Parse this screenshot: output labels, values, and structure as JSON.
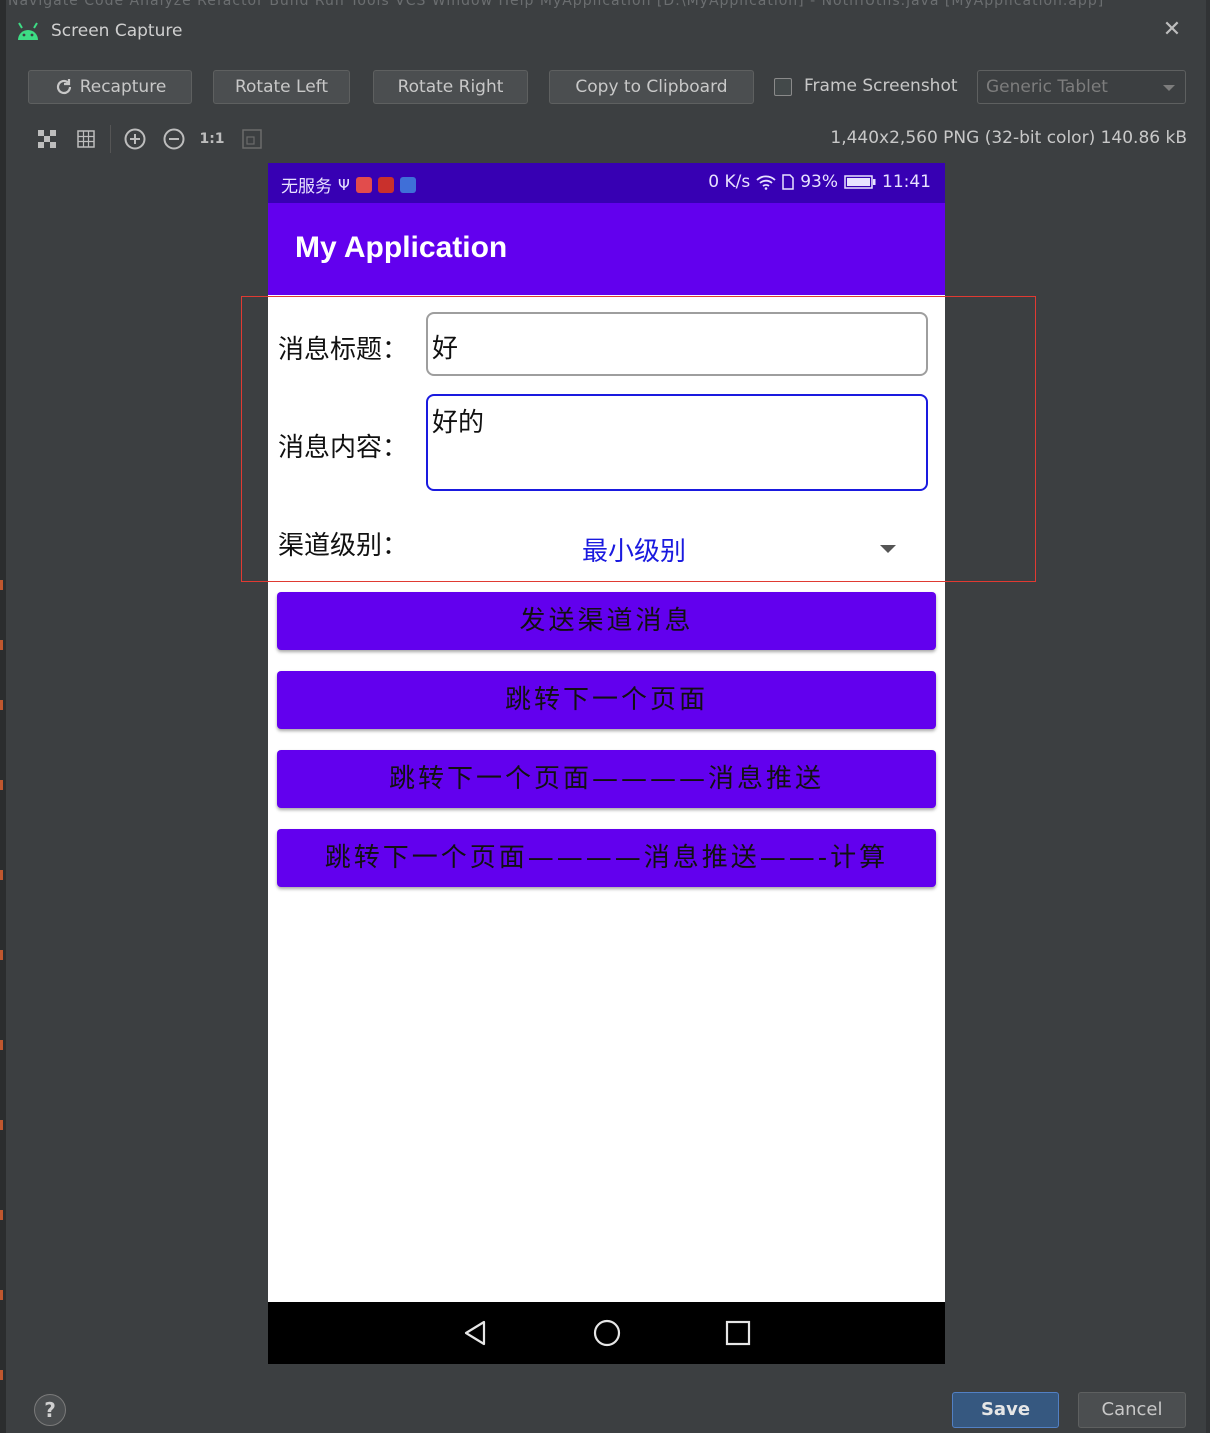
{
  "ide": {
    "menu_strip": "Navigate  Code  Analyze  Refactor  Build  Run  Tools  VCS  Window  Help     MyApplication [D:\\MyApplication] - NotifiUtils.java [MyApplication.app]"
  },
  "dialog": {
    "title": "Screen Capture",
    "buttons": {
      "recapture": "Recapture",
      "rotate_left": "Rotate Left",
      "rotate_right": "Rotate Right",
      "copy": "Copy to Clipboard"
    },
    "frame_screenshot_label": "Frame Screenshot",
    "frame_screenshot_checked": false,
    "device_select": "Generic Tablet",
    "toolbar_icons": [
      "checker-icon",
      "grid-icon",
      "zoom-in-icon",
      "zoom-out-icon",
      "actual-size-icon",
      "fit-icon"
    ],
    "zoom_actual_label": "1:1",
    "image_info": "1,440x2,560 PNG (32-bit color) 140.86 kB",
    "save": "Save",
    "cancel": "Cancel",
    "help": "?"
  },
  "phone": {
    "status": {
      "carrier": "无服务",
      "speed": "0 K/s",
      "battery": "93%",
      "time": "11:41"
    },
    "app_title": "My Application",
    "form": {
      "title_label": "消息标题：",
      "title_value": "好",
      "content_label": "消息内容：",
      "content_value": "好的",
      "channel_label": "渠道级别：",
      "channel_value": "最小级别"
    },
    "buttons": [
      "发送渠道消息",
      "跳转下一个页面",
      "跳转下一个页面————消息推送",
      "跳转下一个页面————消息推送——-计算"
    ]
  },
  "colors": {
    "status_bar": "#3700b3",
    "app_bar": "#6200ee",
    "button": "#6200ee",
    "spinner_text": "#1a1adf",
    "focus_border": "#1a1adf",
    "highlight_box": "#e03a32"
  }
}
